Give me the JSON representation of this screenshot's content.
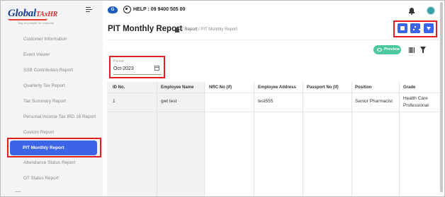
{
  "sidebar": {
    "logo": {
      "brand_main": "Global",
      "brand_tag": "TAxHR",
      "tagline": "Tag all people for success"
    },
    "items": [
      {
        "label": "Customer Information",
        "active": false
      },
      {
        "label": "Event Viewer",
        "active": false
      },
      {
        "label": "SSB Contribution Report",
        "active": false
      },
      {
        "label": "Quarterly Tax Report",
        "active": false
      },
      {
        "label": "Tax Summary Report",
        "active": false
      },
      {
        "label": "Personal Income Tax IRD 16 Report",
        "active": false
      },
      {
        "label": "Custom Report",
        "active": false
      },
      {
        "label": "PIT Monthly Report",
        "active": true
      },
      {
        "label": "Attendance Status Report",
        "active": false
      },
      {
        "label": "OT Status Report",
        "active": false
      }
    ]
  },
  "topbar": {
    "help": "HELP : 09 9400 505 00"
  },
  "page": {
    "title": "PIT Monthly Report",
    "breadcrumb": {
      "sep": "/",
      "report": "Report",
      "current": "PIT Monthly Report"
    },
    "preview_label": "Preview"
  },
  "filters": {
    "period_label": "Period",
    "period_value": "Oct-2023"
  },
  "table": {
    "columns": [
      "ID No.",
      "Employee Name",
      "NRC No (if)",
      "Employee Address",
      "Passport No (if)",
      "Position",
      "Grade"
    ],
    "rows": [
      {
        "id": "1",
        "name": "gwt test",
        "nrc": "",
        "address": "test555",
        "passport": "",
        "position": "Senior Pharmacist",
        "grade": "Health Care Professional"
      }
    ]
  },
  "colors": {
    "accent": "#3c64e6",
    "preview": "#4dc9a0",
    "highlight": "#e02020",
    "brand": "#1d3f91"
  }
}
